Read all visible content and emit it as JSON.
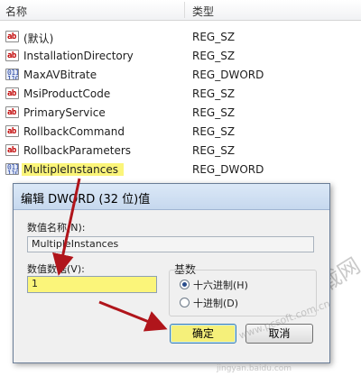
{
  "header": {
    "name_col": "名称",
    "type_col": "类型"
  },
  "rows": [
    {
      "name": "(默认)",
      "type": "REG_SZ",
      "icon": "string-value-icon"
    },
    {
      "name": "InstallationDirectory",
      "type": "REG_SZ",
      "icon": "string-value-icon"
    },
    {
      "name": "MaxAVBitrate",
      "type": "REG_DWORD",
      "icon": "dword-value-icon"
    },
    {
      "name": "MsiProductCode",
      "type": "REG_SZ",
      "icon": "string-value-icon"
    },
    {
      "name": "PrimaryService",
      "type": "REG_SZ",
      "icon": "string-value-icon"
    },
    {
      "name": "RollbackCommand",
      "type": "REG_SZ",
      "icon": "string-value-icon"
    },
    {
      "name": "RollbackParameters",
      "type": "REG_SZ",
      "icon": "string-value-icon"
    },
    {
      "name": "MultipleInstances",
      "type": "REG_DWORD",
      "icon": "dword-value-icon"
    }
  ],
  "icons": {
    "sz_glyph": "ab",
    "dword_glyph": "011\n110"
  },
  "dialog": {
    "title": "编辑 DWORD (32 位)值",
    "value_name_label": "数值名称(N):",
    "value_name": "MultipleInstances",
    "value_data_label": "数值数据(V):",
    "value_data": "1",
    "base_label": "基数",
    "radio_hex": "十六进制(H)",
    "radio_dec": "十进制(D)",
    "selected_base": "hex",
    "ok": "确定",
    "cancel": "取消"
  },
  "watermark": {
    "big": "PC下载网",
    "url": "www.pcsoft.com.cn",
    "bottom": "jingyan.baidu.com"
  },
  "colors": {
    "highlight": "#fbf57a",
    "arrow": "#b0151b"
  }
}
